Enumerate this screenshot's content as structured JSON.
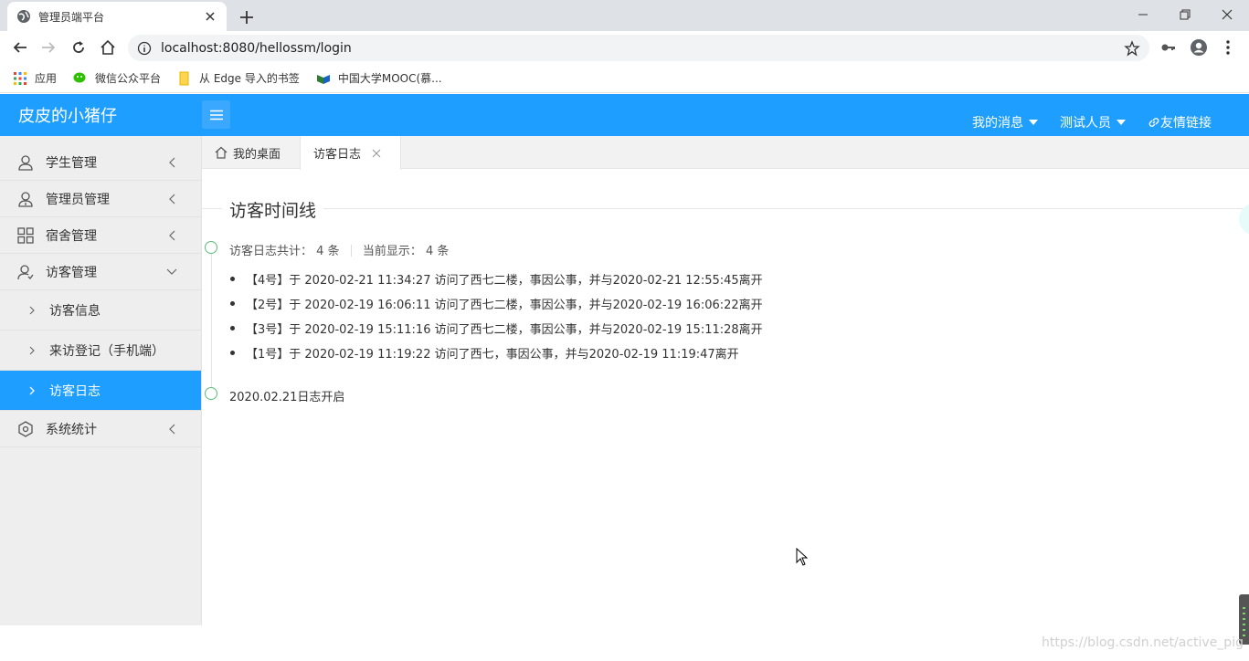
{
  "browser": {
    "tab_title": "管理员端平台",
    "url": "localhost:8080/hellossm/login",
    "bookmarks": [
      {
        "label": "应用",
        "icon": "apps-grid-icon"
      },
      {
        "label": "微信公众平台",
        "icon": "wechat-icon"
      },
      {
        "label": "从 Edge 导入的书签",
        "icon": "folder-icon"
      },
      {
        "label": "中国大学MOOC(慕...",
        "icon": "mooc-icon"
      }
    ]
  },
  "header": {
    "logo": "皮皮的小猪仔",
    "nav": [
      {
        "label": "我的消息",
        "caret": true
      },
      {
        "label": "测试人员",
        "caret": true
      },
      {
        "label": "友情链接",
        "icon": "link-icon"
      }
    ]
  },
  "sidebar": {
    "items": [
      {
        "label": "学生管理",
        "icon": "user-icon",
        "expanded": false
      },
      {
        "label": "管理员管理",
        "icon": "admin-user-icon",
        "expanded": false
      },
      {
        "label": "宿舍管理",
        "icon": "grid-icon",
        "expanded": false
      },
      {
        "label": "访客管理",
        "icon": "visitor-icon",
        "expanded": true,
        "children": [
          {
            "label": "访客信息",
            "active": false
          },
          {
            "label": "来访登记（手机端）",
            "active": false
          },
          {
            "label": "访客日志",
            "active": true
          }
        ]
      },
      {
        "label": "系统统计",
        "icon": "stats-icon",
        "expanded": false
      }
    ]
  },
  "content_tabs": [
    {
      "label": "我的桌面",
      "icon": "home-icon",
      "active": false,
      "closable": false
    },
    {
      "label": "访客日志",
      "active": true,
      "closable": true
    }
  ],
  "main": {
    "title": "访客时间线",
    "summary": {
      "total_label": "访客日志共计：",
      "total_value": "4 条",
      "shown_label": "当前显示：",
      "shown_value": "4 条"
    },
    "records": [
      "【4号】于 2020-02-21 11:34:27 访问了西七二楼，事因公事，并与2020-02-21 12:55:45离开",
      "【2号】于 2020-02-19 16:06:11 访问了西七二楼，事因公事，并与2020-02-19 16:06:22离开",
      "【3号】于 2020-02-19 15:11:16 访问了西七二楼，事因公事，并与2020-02-19 15:11:28离开",
      "【1号】于 2020-02-19 11:19:22 访问了西七，事因公事，并与2020-02-19 11:19:47离开"
    ],
    "footer_note": "2020.02.21日志开启"
  },
  "watermark": "https://blog.csdn.net/active_pig",
  "colors": {
    "accent": "#1e9fff",
    "timeline_node": "#5fb878",
    "sidebar_bg": "#eeeeee"
  }
}
